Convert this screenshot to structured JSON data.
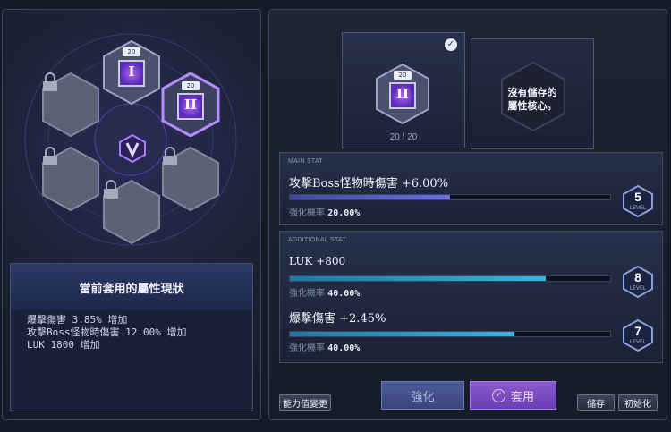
{
  "hex_slots": {
    "slot1": {
      "level_badge": "20",
      "numeral": "I",
      "state": "equipped"
    },
    "slot2": {
      "level_badge": "20",
      "numeral": "II",
      "state": "selected"
    }
  },
  "status": {
    "title": "當前套用的屬性現狀",
    "lines": [
      "爆擊傷害 3.85% 增加",
      "攻擊Boss怪物時傷害 12.00% 增加",
      "LUK 1800 增加"
    ]
  },
  "core_card": {
    "badge": "20",
    "numeral": "II",
    "count_current": "20",
    "count_separator": "/",
    "count_max": "20"
  },
  "empty_card": {
    "line1": "沒有儲存的",
    "line2": "屬性核心。"
  },
  "main_stat": {
    "section_label": "MAIN STAT",
    "name": "攻擊Boss怪物時傷害 +6.00%",
    "progress": 0.5,
    "rate_label": "強化機率",
    "rate_value": "20.00%",
    "level": "5",
    "level_label": "LEVEL"
  },
  "additional_stat": {
    "section_label": "ADDITIONAL STAT",
    "stats": [
      {
        "name": "LUK +800",
        "progress": 0.8,
        "rate_label": "強化機率",
        "rate_value": "40.00%",
        "level": "8",
        "level_label": "LEVEL"
      },
      {
        "name": "爆擊傷害 +2.45%",
        "progress": 0.7,
        "rate_label": "強化機率",
        "rate_value": "40.00%",
        "level": "7",
        "level_label": "LEVEL"
      }
    ]
  },
  "buttons": {
    "ability_change": "能力值變更",
    "enhance": "強化",
    "apply": "套用",
    "save": "儲存",
    "reset": "初始化"
  },
  "colors": {
    "accent_purple": "#8a5ad0",
    "accent_cyan": "#35b5e2",
    "gem_purple": "#7b3fd6"
  }
}
